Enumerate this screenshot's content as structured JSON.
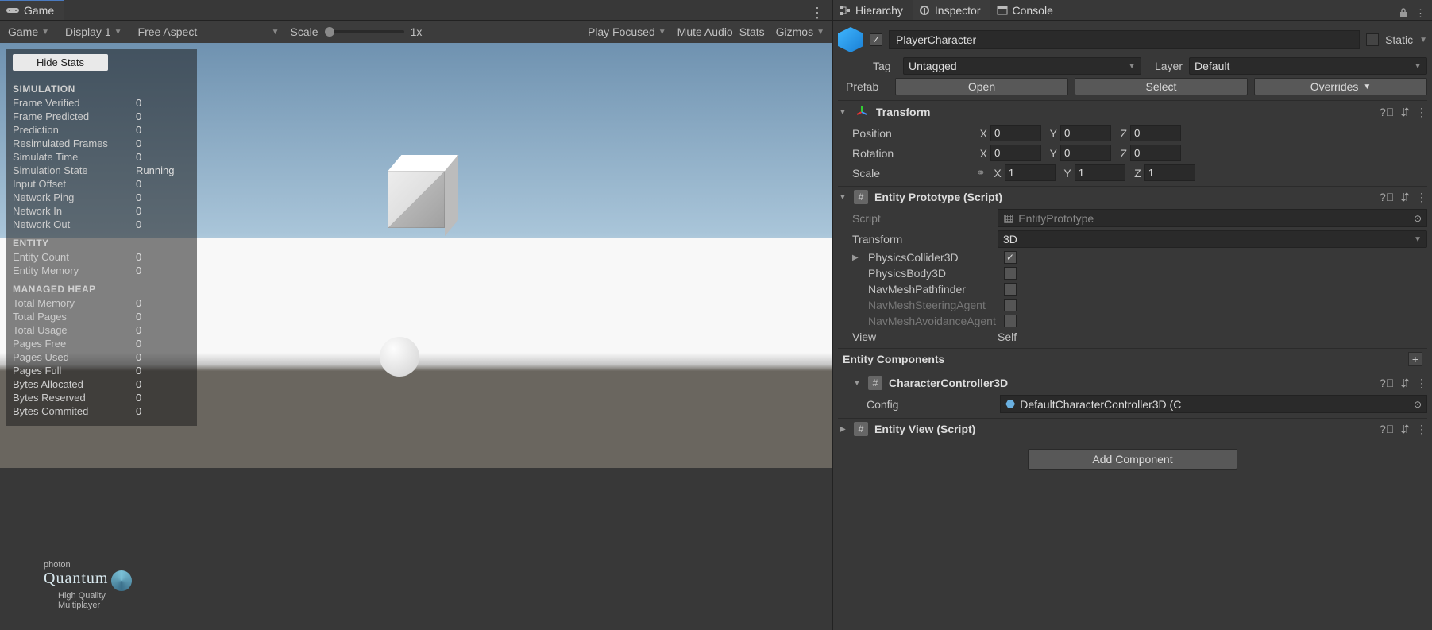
{
  "gameTab": {
    "label": "Game"
  },
  "gameToolbar": {
    "mode": "Game",
    "display": "Display 1",
    "aspect": "Free Aspect",
    "scaleLabel": "Scale",
    "scaleValue": "1x",
    "play": "Play Focused",
    "mute": "Mute Audio",
    "stats": "Stats",
    "gizmos": "Gizmos"
  },
  "statsOverlay": {
    "hideBtn": "Hide Stats",
    "sections": [
      {
        "title": "SIMULATION",
        "rows": [
          {
            "k": "Frame Verified",
            "v": "0"
          },
          {
            "k": "Frame Predicted",
            "v": "0"
          },
          {
            "k": "Prediction",
            "v": "0"
          },
          {
            "k": "Resimulated Frames",
            "v": "0"
          },
          {
            "k": "Simulate Time",
            "v": "0"
          },
          {
            "k": "Simulation State",
            "v": "Running"
          },
          {
            "k": "Input Offset",
            "v": "0"
          },
          {
            "k": "Network Ping",
            "v": "0"
          },
          {
            "k": "Network In",
            "v": "0"
          },
          {
            "k": "Network Out",
            "v": "0"
          }
        ]
      },
      {
        "title": "ENTITY",
        "rows": [
          {
            "k": "Entity Count",
            "v": "0"
          },
          {
            "k": "Entity Memory",
            "v": "0"
          }
        ]
      },
      {
        "title": "MANAGED HEAP",
        "rows": [
          {
            "k": "Total Memory",
            "v": "0"
          },
          {
            "k": "Total Pages",
            "v": "0"
          },
          {
            "k": "Total Usage",
            "v": "0"
          },
          {
            "k": "Pages Free",
            "v": "0"
          },
          {
            "k": "Pages Used",
            "v": "0"
          },
          {
            "k": "Pages Full",
            "v": "0"
          },
          {
            "k": "Bytes Allocated",
            "v": "0"
          },
          {
            "k": "Bytes Reserved",
            "v": "0"
          },
          {
            "k": "Bytes Commited",
            "v": "0"
          }
        ]
      }
    ]
  },
  "logo": {
    "top": "photon",
    "brand": "Quantum",
    "sub1": "High Quality",
    "sub2": "Multiplayer"
  },
  "rightTabs": {
    "hierarchy": "Hierarchy",
    "inspector": "Inspector",
    "console": "Console"
  },
  "inspector": {
    "enabled": true,
    "name": "PlayerCharacter",
    "staticLabel": "Static",
    "tagLabel": "Tag",
    "tag": "Untagged",
    "layerLabel": "Layer",
    "layer": "Default",
    "prefabLabel": "Prefab",
    "openBtn": "Open",
    "selectBtn": "Select",
    "overridesBtn": "Overrides",
    "transform": {
      "title": "Transform",
      "position": {
        "label": "Position",
        "x": "0",
        "y": "0",
        "z": "0"
      },
      "rotation": {
        "label": "Rotation",
        "x": "0",
        "y": "0",
        "z": "0"
      },
      "scale": {
        "label": "Scale",
        "x": "1",
        "y": "1",
        "z": "1"
      }
    },
    "entityPrototype": {
      "title": "Entity Prototype (Script)",
      "scriptLabel": "Script",
      "script": "EntityPrototype",
      "transformLabel": "Transform",
      "transformVal": "3D",
      "props": [
        {
          "label": "PhysicsCollider3D",
          "checked": true,
          "fold": true
        },
        {
          "label": "PhysicsBody3D",
          "checked": false
        },
        {
          "label": "NavMeshPathfinder",
          "checked": false
        },
        {
          "label": "NavMeshSteeringAgent",
          "checked": false,
          "dim": true
        },
        {
          "label": "NavMeshAvoidanceAgent",
          "checked": false,
          "dim": true
        }
      ],
      "viewLabel": "View",
      "viewVal": "Self"
    },
    "entityComponentsTitle": "Entity Components",
    "characterController": {
      "title": "CharacterController3D",
      "configLabel": "Config",
      "configVal": "DefaultCharacterController3D (C"
    },
    "entityView": {
      "title": "Entity View (Script)"
    },
    "addComponent": "Add Component"
  }
}
